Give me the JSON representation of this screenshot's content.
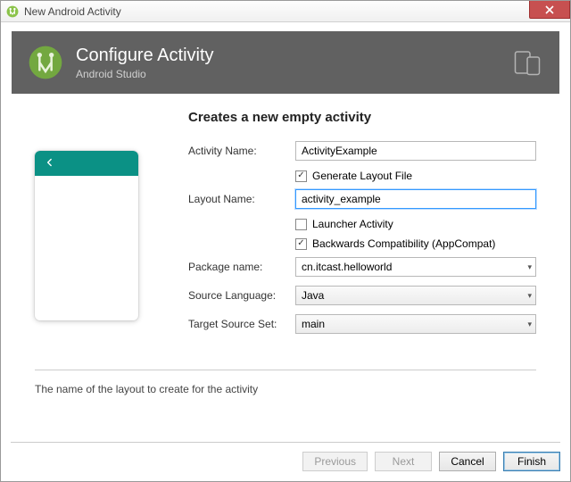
{
  "window": {
    "title": "New Android Activity"
  },
  "header": {
    "title": "Configure Activity",
    "subtitle": "Android Studio"
  },
  "form": {
    "heading": "Creates a new empty activity",
    "activity_name_label": "Activity Name:",
    "activity_name_value": "ActivityExample",
    "generate_layout_label": "Generate Layout File",
    "generate_layout_checked": true,
    "layout_name_label": "Layout Name:",
    "layout_name_value": "activity_example",
    "launcher_label": "Launcher Activity",
    "launcher_checked": false,
    "backcompat_label": "Backwards Compatibility (AppCompat)",
    "backcompat_checked": true,
    "package_label": "Package name:",
    "package_value": "cn.itcast.helloworld",
    "source_lang_label": "Source Language:",
    "source_lang_value": "Java",
    "target_set_label": "Target Source Set:",
    "target_set_value": "main"
  },
  "hint": "The name of the layout to create for the activity",
  "buttons": {
    "previous": "Previous",
    "next": "Next",
    "cancel": "Cancel",
    "finish": "Finish"
  },
  "icons": {
    "close": "close-icon",
    "back_arrow": "back-arrow-icon",
    "devices": "devices-icon",
    "android_studio_logo": "android-studio-logo"
  }
}
